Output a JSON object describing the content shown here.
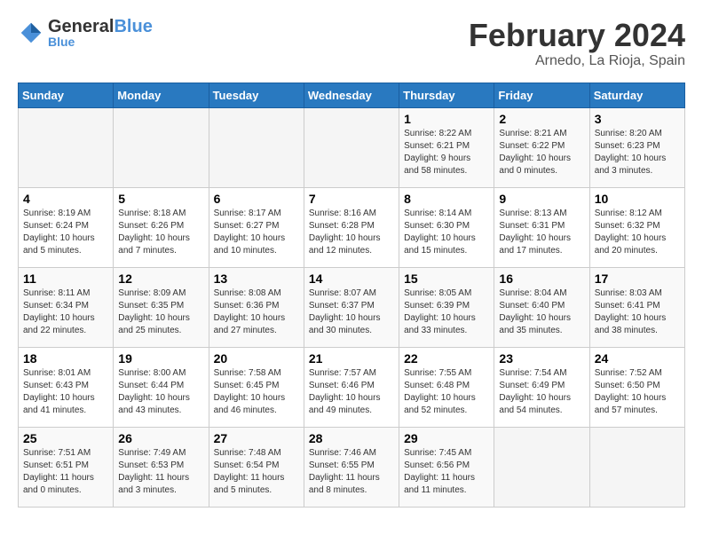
{
  "header": {
    "logo_general": "General",
    "logo_blue": "Blue",
    "month": "February 2024",
    "location": "Arnedo, La Rioja, Spain"
  },
  "days_of_week": [
    "Sunday",
    "Monday",
    "Tuesday",
    "Wednesday",
    "Thursday",
    "Friday",
    "Saturday"
  ],
  "weeks": [
    [
      {
        "day": "",
        "info": ""
      },
      {
        "day": "",
        "info": ""
      },
      {
        "day": "",
        "info": ""
      },
      {
        "day": "",
        "info": ""
      },
      {
        "day": "1",
        "info": "Sunrise: 8:22 AM\nSunset: 6:21 PM\nDaylight: 9 hours\nand 58 minutes."
      },
      {
        "day": "2",
        "info": "Sunrise: 8:21 AM\nSunset: 6:22 PM\nDaylight: 10 hours\nand 0 minutes."
      },
      {
        "day": "3",
        "info": "Sunrise: 8:20 AM\nSunset: 6:23 PM\nDaylight: 10 hours\nand 3 minutes."
      }
    ],
    [
      {
        "day": "4",
        "info": "Sunrise: 8:19 AM\nSunset: 6:24 PM\nDaylight: 10 hours\nand 5 minutes."
      },
      {
        "day": "5",
        "info": "Sunrise: 8:18 AM\nSunset: 6:26 PM\nDaylight: 10 hours\nand 7 minutes."
      },
      {
        "day": "6",
        "info": "Sunrise: 8:17 AM\nSunset: 6:27 PM\nDaylight: 10 hours\nand 10 minutes."
      },
      {
        "day": "7",
        "info": "Sunrise: 8:16 AM\nSunset: 6:28 PM\nDaylight: 10 hours\nand 12 minutes."
      },
      {
        "day": "8",
        "info": "Sunrise: 8:14 AM\nSunset: 6:30 PM\nDaylight: 10 hours\nand 15 minutes."
      },
      {
        "day": "9",
        "info": "Sunrise: 8:13 AM\nSunset: 6:31 PM\nDaylight: 10 hours\nand 17 minutes."
      },
      {
        "day": "10",
        "info": "Sunrise: 8:12 AM\nSunset: 6:32 PM\nDaylight: 10 hours\nand 20 minutes."
      }
    ],
    [
      {
        "day": "11",
        "info": "Sunrise: 8:11 AM\nSunset: 6:34 PM\nDaylight: 10 hours\nand 22 minutes."
      },
      {
        "day": "12",
        "info": "Sunrise: 8:09 AM\nSunset: 6:35 PM\nDaylight: 10 hours\nand 25 minutes."
      },
      {
        "day": "13",
        "info": "Sunrise: 8:08 AM\nSunset: 6:36 PM\nDaylight: 10 hours\nand 27 minutes."
      },
      {
        "day": "14",
        "info": "Sunrise: 8:07 AM\nSunset: 6:37 PM\nDaylight: 10 hours\nand 30 minutes."
      },
      {
        "day": "15",
        "info": "Sunrise: 8:05 AM\nSunset: 6:39 PM\nDaylight: 10 hours\nand 33 minutes."
      },
      {
        "day": "16",
        "info": "Sunrise: 8:04 AM\nSunset: 6:40 PM\nDaylight: 10 hours\nand 35 minutes."
      },
      {
        "day": "17",
        "info": "Sunrise: 8:03 AM\nSunset: 6:41 PM\nDaylight: 10 hours\nand 38 minutes."
      }
    ],
    [
      {
        "day": "18",
        "info": "Sunrise: 8:01 AM\nSunset: 6:43 PM\nDaylight: 10 hours\nand 41 minutes."
      },
      {
        "day": "19",
        "info": "Sunrise: 8:00 AM\nSunset: 6:44 PM\nDaylight: 10 hours\nand 43 minutes."
      },
      {
        "day": "20",
        "info": "Sunrise: 7:58 AM\nSunset: 6:45 PM\nDaylight: 10 hours\nand 46 minutes."
      },
      {
        "day": "21",
        "info": "Sunrise: 7:57 AM\nSunset: 6:46 PM\nDaylight: 10 hours\nand 49 minutes."
      },
      {
        "day": "22",
        "info": "Sunrise: 7:55 AM\nSunset: 6:48 PM\nDaylight: 10 hours\nand 52 minutes."
      },
      {
        "day": "23",
        "info": "Sunrise: 7:54 AM\nSunset: 6:49 PM\nDaylight: 10 hours\nand 54 minutes."
      },
      {
        "day": "24",
        "info": "Sunrise: 7:52 AM\nSunset: 6:50 PM\nDaylight: 10 hours\nand 57 minutes."
      }
    ],
    [
      {
        "day": "25",
        "info": "Sunrise: 7:51 AM\nSunset: 6:51 PM\nDaylight: 11 hours\nand 0 minutes."
      },
      {
        "day": "26",
        "info": "Sunrise: 7:49 AM\nSunset: 6:53 PM\nDaylight: 11 hours\nand 3 minutes."
      },
      {
        "day": "27",
        "info": "Sunrise: 7:48 AM\nSunset: 6:54 PM\nDaylight: 11 hours\nand 5 minutes."
      },
      {
        "day": "28",
        "info": "Sunrise: 7:46 AM\nSunset: 6:55 PM\nDaylight: 11 hours\nand 8 minutes."
      },
      {
        "day": "29",
        "info": "Sunrise: 7:45 AM\nSunset: 6:56 PM\nDaylight: 11 hours\nand 11 minutes."
      },
      {
        "day": "",
        "info": ""
      },
      {
        "day": "",
        "info": ""
      }
    ]
  ]
}
